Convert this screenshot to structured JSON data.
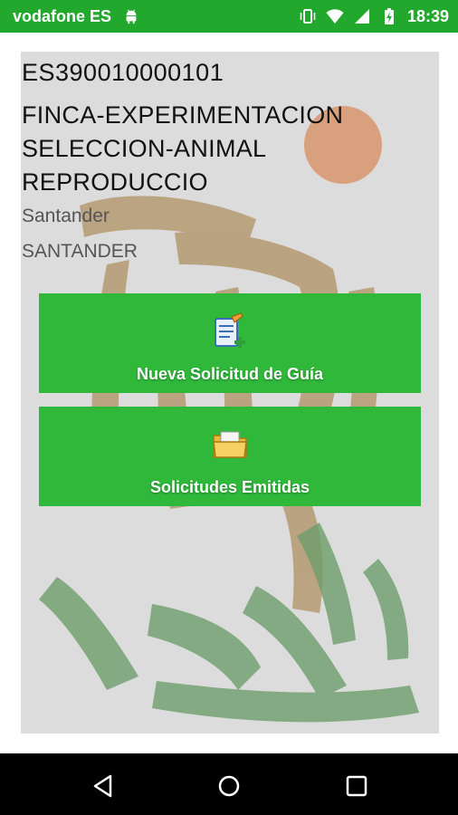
{
  "status_bar": {
    "carrier": "vodafone ES",
    "time": "18:39",
    "icons": [
      "android-icon",
      "vibrate-icon",
      "wifi-icon",
      "signal-icon",
      "battery-charging-icon"
    ]
  },
  "farm": {
    "code": "ES390010000101",
    "name": "FINCA-EXPERIMENTACION SELECCION-ANIMAL REPRODUCCIO",
    "city": "Santander",
    "province": "SANTANDER"
  },
  "actions": [
    {
      "label": "Nueva Solicitud de Guía",
      "icon": "new-document-icon"
    },
    {
      "label": "Solicitudes Emitidas",
      "icon": "folder-icon"
    }
  ],
  "nav_bar": {
    "icons": [
      "back-icon",
      "home-icon",
      "recents-icon"
    ]
  },
  "colors": {
    "status_bar": "#23a82e",
    "button": "#2fb83a",
    "card_background": "#dcdcdc",
    "logo_tan": "#b59a72",
    "logo_green": "#6e9e6c",
    "logo_sun": "#d9a07e"
  }
}
